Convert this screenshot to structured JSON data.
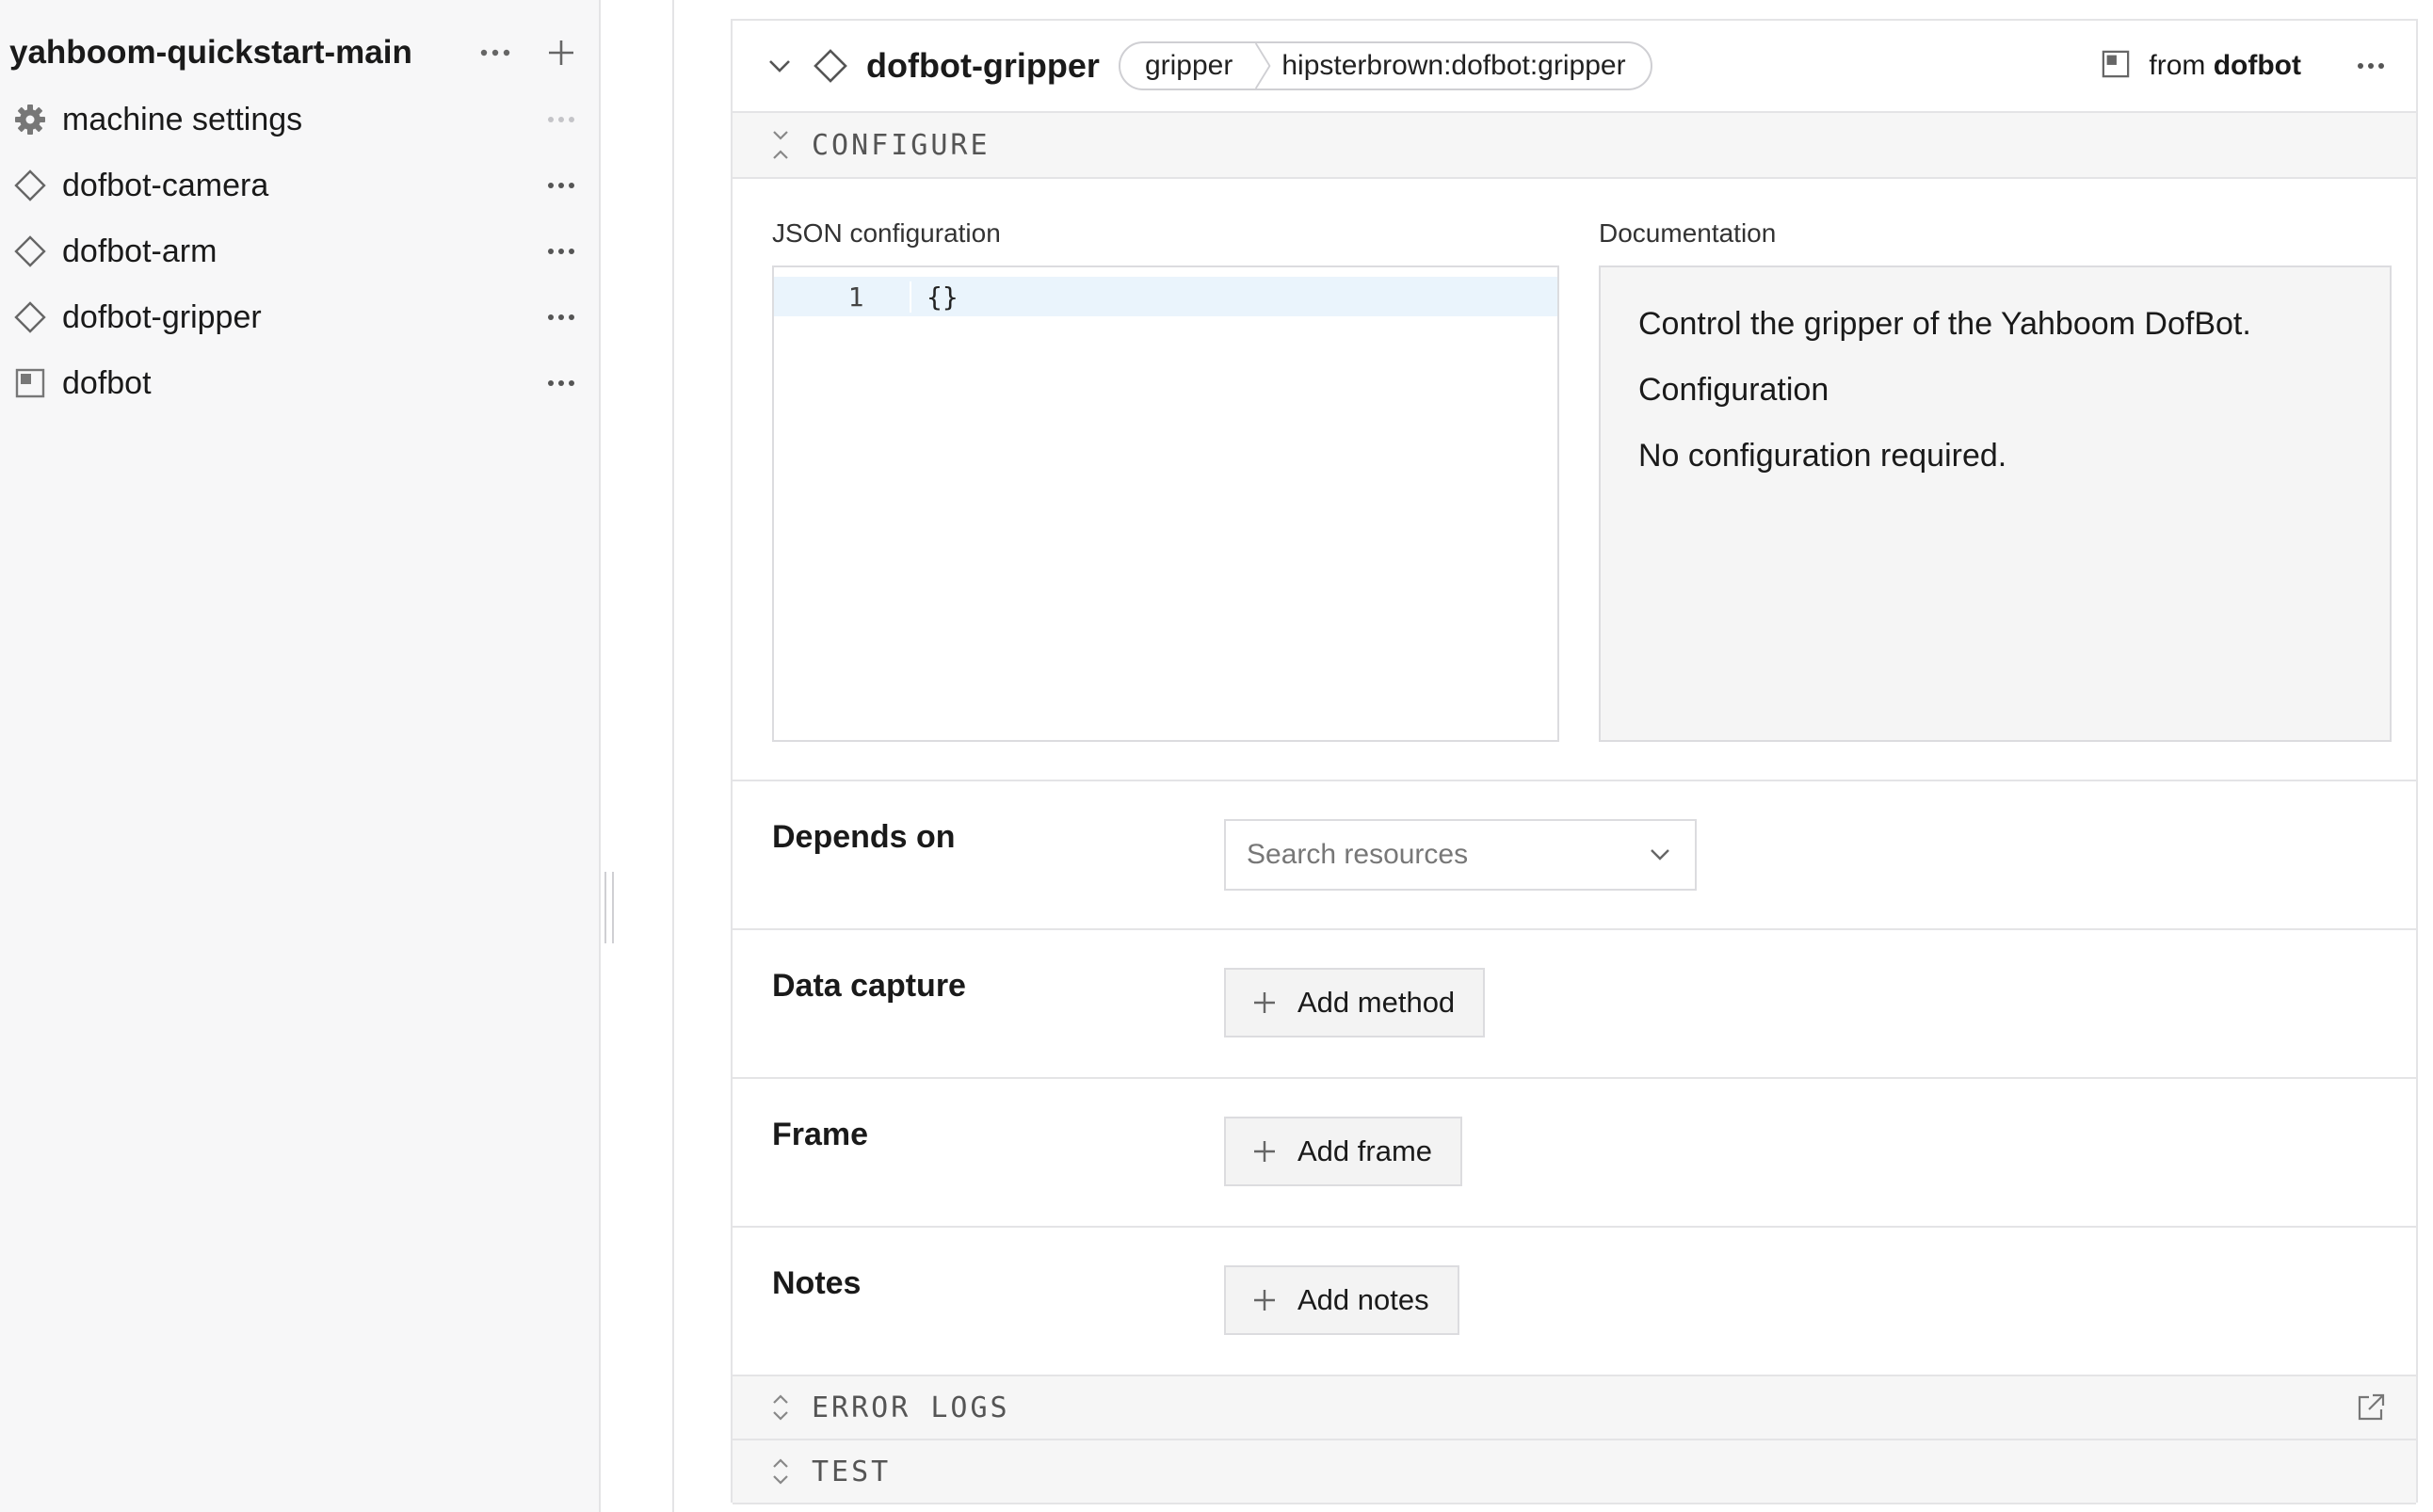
{
  "sidebar": {
    "title": "yahboom-quickstart-main",
    "items": [
      {
        "label": "machine settings",
        "icon": "gear-icon"
      },
      {
        "label": "dofbot-camera",
        "icon": "diamond-icon"
      },
      {
        "label": "dofbot-arm",
        "icon": "diamond-icon"
      },
      {
        "label": "dofbot-gripper",
        "icon": "diamond-icon"
      },
      {
        "label": "dofbot",
        "icon": "fragment-icon"
      }
    ]
  },
  "component": {
    "name": "dofbot-gripper",
    "type_chip": "gripper",
    "model_chip": "hipsterbrown:dofbot:gripper",
    "from_prefix": "from",
    "from_source": "dofbot"
  },
  "configure": {
    "section_title": "CONFIGURE",
    "json_label": "JSON configuration",
    "editor": {
      "line_number": "1",
      "code": "{}"
    },
    "docs_label": "Documentation",
    "docs": [
      "Control the gripper of the Yahboom DofBot.",
      "Configuration",
      "No configuration required."
    ]
  },
  "depends_on": {
    "label": "Depends on",
    "placeholder": "Search resources"
  },
  "data_capture": {
    "label": "Data capture",
    "button": "Add method"
  },
  "frame": {
    "label": "Frame",
    "button": "Add frame"
  },
  "notes": {
    "label": "Notes",
    "button": "Add notes"
  },
  "error_logs": {
    "section_title": "ERROR LOGS"
  },
  "test": {
    "section_title": "TEST"
  },
  "colors": {
    "sidebar_bg": "#f7f7f8",
    "section_bg": "#f6f6f6",
    "editor_highlight": "#eaf4fc",
    "border": "#e4e4e6"
  }
}
